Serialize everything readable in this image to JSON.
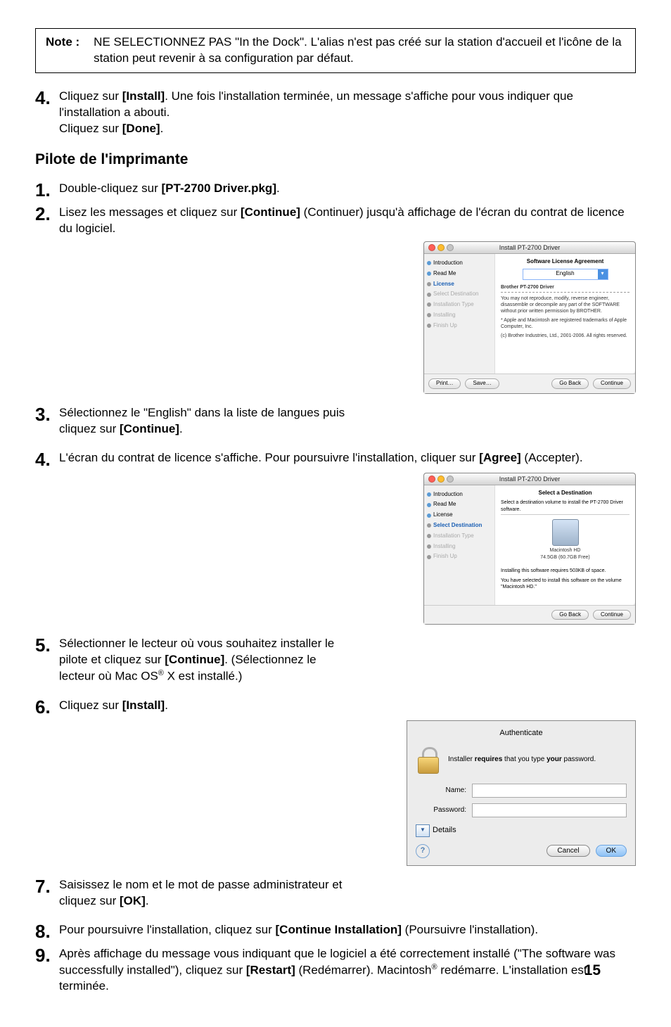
{
  "note": {
    "label": "Note :",
    "text": "NE SELECTIONNEZ PAS \"In the Dock\". L'alias n'est pas créé sur la station d'accueil et l'icône de la station peut revenir à sa configuration par défaut."
  },
  "top_step4": {
    "num": "4.",
    "text1": "Cliquez sur ",
    "b1": "[Install]",
    "text2": ". Une fois l'installation terminée, un message s'affiche pour vous indiquer que l'installation a abouti.",
    "text3": "Cliquez sur ",
    "b2": "[Done]",
    "text4": "."
  },
  "section_title": "Pilote de l'imprimante",
  "s1": {
    "num": "1.",
    "t1": "Double-cliquez sur ",
    "b1": "[PT-2700 Driver.pkg]",
    "t2": "."
  },
  "s2": {
    "num": "2.",
    "t1": "Lisez les messages et cliquez sur ",
    "b1": "[Continue]",
    "t2": " (Continuer) jusqu'à affichage de l'écran du contrat de licence du logiciel."
  },
  "s3": {
    "num": "3.",
    "t1": "Sélectionnez le \"English\" dans la liste de langues puis cliquez sur ",
    "b1": "[Continue]",
    "t2": "."
  },
  "s4": {
    "num": "4.",
    "t1": "L'écran du contrat de licence s'affiche. Pour poursuivre l'installation, cliquer sur ",
    "b1": "[Agree]",
    "t2": " (Accepter)."
  },
  "s5": {
    "num": "5.",
    "t1": "Sélectionner le lecteur où vous souhaitez installer le pilote et cliquez sur ",
    "b1": "[Continue]",
    "t2": ". (Sélectionnez le lecteur où Mac OS",
    "sup": "®",
    "t3": " X est installé.)"
  },
  "s6": {
    "num": "6.",
    "t1": "Cliquez sur ",
    "b1": "[Install]",
    "t2": "."
  },
  "s7": {
    "num": "7.",
    "t1": "Saisissez le nom et le mot de passe administrateur et cliquez sur ",
    "b1": "[OK]",
    "t2": "."
  },
  "s8": {
    "num": "8.",
    "t1": "Pour poursuivre l'installation, cliquez sur ",
    "b1": "[Continue Installation]",
    "t2": " (Poursuivre l'installation)."
  },
  "s9": {
    "num": "9.",
    "t1": "Après affichage du message vous indiquant que le logiciel a été correctement installé (\"The software was successfully installed\"), cliquez sur ",
    "b1": "[Restart]",
    "t2": " (Redémarrer). Macintosh",
    "sup": "®",
    "t3": " redémarre. L'installation est terminée."
  },
  "fig1": {
    "title": "Install PT-2700 Driver",
    "heading": "Software License Agreement",
    "lang": "English",
    "product": "Brother PT-2700 Driver",
    "p1": "You may not reproduce, modify, reverse engineer, disassemble or decompile any part of the SOFTWARE without prior written permission by BROTHER.",
    "p2": "* Apple and Macintosh are registered trademarks of Apple Computer, Inc.",
    "p3": "(c) Brother Industries, Ltd., 2001-2006. All rights reserved.",
    "sidebar": [
      "Introduction",
      "Read Me",
      "License",
      "Select Destination",
      "Installation Type",
      "Installing",
      "Finish Up"
    ],
    "btn_print": "Print…",
    "btn_save": "Save…",
    "btn_back": "Go Back",
    "btn_cont": "Continue"
  },
  "fig2": {
    "title": "Install PT-2700 Driver",
    "heading": "Select a Destination",
    "msg1": "Select a destination volume to install the PT-2700 Driver software.",
    "hd_name": "Macintosh HD",
    "hd_size": "74.5GB (60.7GB Free)",
    "msg2": "Installing this software requires 503KB of space.",
    "msg3": "You have selected to install this software on the volume \"Macintosh HD.\"",
    "sidebar": [
      "Introduction",
      "Read Me",
      "License",
      "Select Destination",
      "Installation Type",
      "Installing",
      "Finish Up"
    ],
    "btn_back": "Go Back",
    "btn_cont": "Continue"
  },
  "fig3": {
    "title": "Authenticate",
    "msg": "Installer requires that you type your password.",
    "l_name": "Name:",
    "l_pass": "Password:",
    "details": "Details",
    "cancel": "Cancel",
    "ok": "OK"
  },
  "page": "15"
}
